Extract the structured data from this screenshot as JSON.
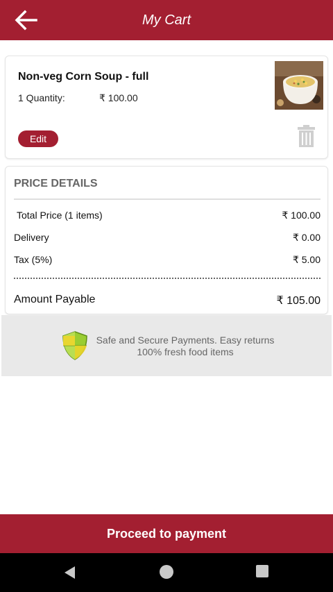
{
  "header": {
    "title": "My Cart",
    "back_icon": "arrow-left-icon",
    "bg_color": "#a31f31"
  },
  "cart_item": {
    "name": "Non-veg Corn Soup - full",
    "quantity_label": "1 Quantity:",
    "price": "₹ 100.00",
    "image_icon": "soup-bowl-image",
    "edit_label": "Edit",
    "delete_icon": "trash-icon"
  },
  "price_details": {
    "title": "PRICE DETAILS",
    "rows": [
      {
        "label": "Total Price (1 items)",
        "value": "₹ 100.00"
      },
      {
        "label": "Delivery",
        "value": "₹ 0.00"
      },
      {
        "label": "Tax (5%)",
        "value": "₹ 5.00"
      }
    ],
    "amount_payable_label": "Amount Payable",
    "amount_payable_value": "₹ 105.00"
  },
  "secure_banner": {
    "icon": "shield-icon",
    "line1": "Safe and Secure Payments. Easy returns",
    "line2": "100% fresh food items"
  },
  "footer": {
    "proceed_label": "Proceed to payment"
  },
  "system_nav": {
    "back_icon": "nav-back-icon",
    "home_icon": "nav-home-icon",
    "recent_icon": "nav-recent-icon"
  }
}
